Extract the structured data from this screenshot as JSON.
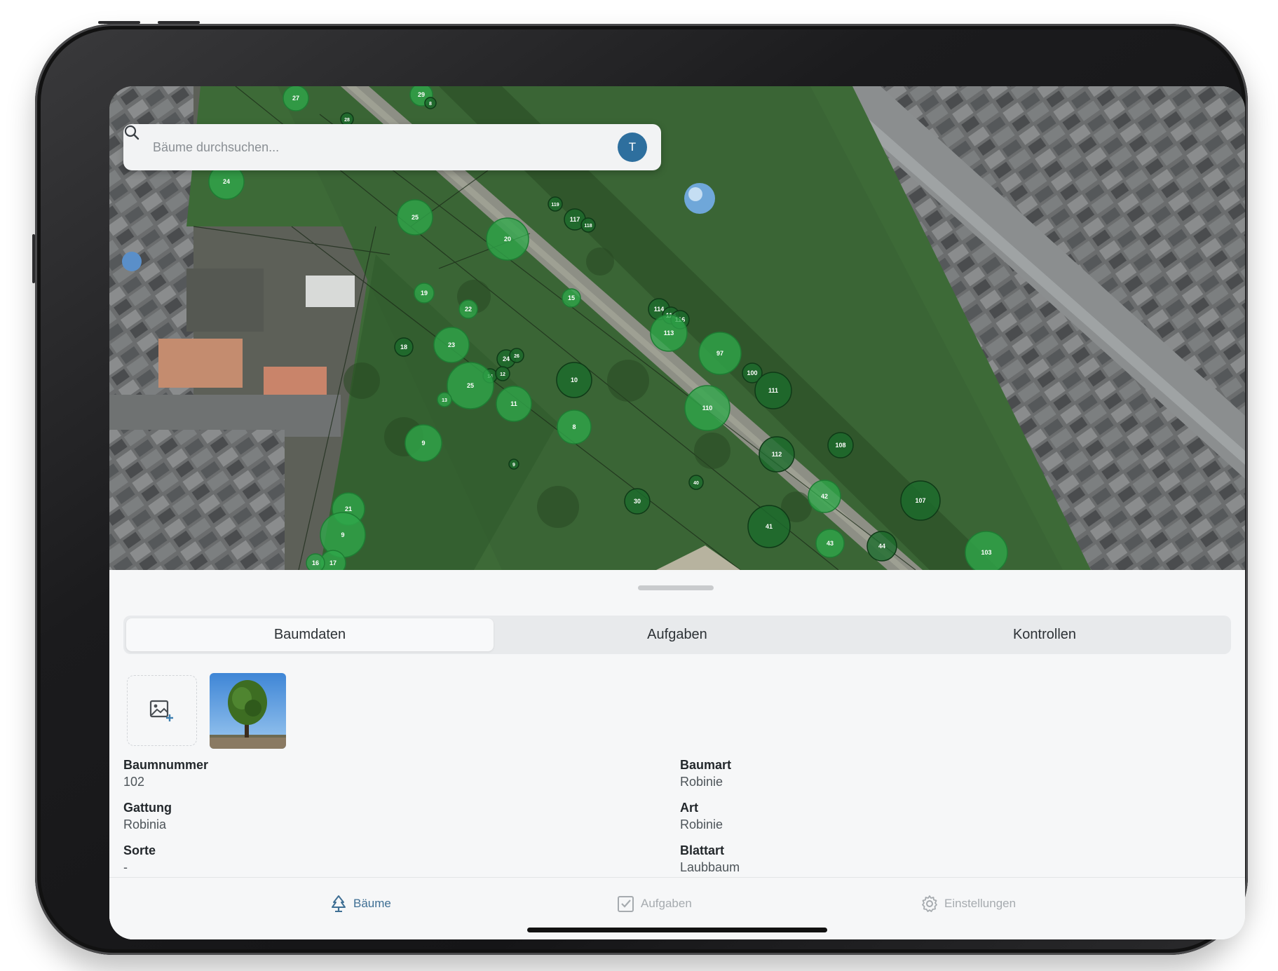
{
  "search": {
    "placeholder": "Bäume durchsuchen...",
    "avatar_initial": "T"
  },
  "map": {
    "tree_markers": [
      {
        "label": "27"
      },
      {
        "label": "29"
      },
      {
        "label": "8"
      },
      {
        "label": "28"
      },
      {
        "label": "24"
      },
      {
        "label": "25"
      },
      {
        "label": "20"
      },
      {
        "label": "119"
      },
      {
        "label": "117"
      },
      {
        "label": "118"
      },
      {
        "label": "19"
      },
      {
        "label": "22"
      },
      {
        "label": "15"
      },
      {
        "label": "18"
      },
      {
        "label": "23"
      },
      {
        "label": "24"
      },
      {
        "label": "26"
      },
      {
        "label": "14"
      },
      {
        "label": "12"
      },
      {
        "label": "25"
      },
      {
        "label": "13"
      },
      {
        "label": "11"
      },
      {
        "label": "10"
      },
      {
        "label": "8"
      },
      {
        "label": "9"
      },
      {
        "label": "114"
      },
      {
        "label": "115"
      },
      {
        "label": "116"
      },
      {
        "label": "113"
      },
      {
        "label": "97"
      },
      {
        "label": "100"
      },
      {
        "label": "111"
      },
      {
        "label": "110"
      },
      {
        "label": "108"
      },
      {
        "label": "112"
      },
      {
        "label": "9"
      },
      {
        "label": "21"
      },
      {
        "label": "9"
      },
      {
        "label": "30"
      },
      {
        "label": "40"
      },
      {
        "label": "42"
      },
      {
        "label": "41"
      },
      {
        "label": "43"
      },
      {
        "label": "44"
      },
      {
        "label": "107"
      },
      {
        "label": "103"
      },
      {
        "label": "17"
      },
      {
        "label": "16"
      }
    ]
  },
  "tabs": {
    "baumdaten": "Baumdaten",
    "aufgaben": "Aufgaben",
    "kontrollen": "Kontrollen"
  },
  "details": {
    "baumnummer_label": "Baumnummer",
    "baumnummer": "102",
    "gattung_label": "Gattung",
    "gattung": "Robinia",
    "sorte_label": "Sorte",
    "sorte": "-",
    "baumart_label": "Baumart",
    "baumart": "Robinie",
    "art_label": "Art",
    "art": "Robinie",
    "blattart_label": "Blattart",
    "blattart": "Laubbaum"
  },
  "tabbar": {
    "baeume": "Bäume",
    "aufgaben": "Aufgaben",
    "einstellungen": "Einstellungen"
  },
  "colors": {
    "accent": "#2e6f9e",
    "marker_light": "#2fa84a",
    "marker_dark": "#1c6b2c",
    "active_tab": "#3f6f94",
    "inactive_tab": "#a6abaf"
  }
}
